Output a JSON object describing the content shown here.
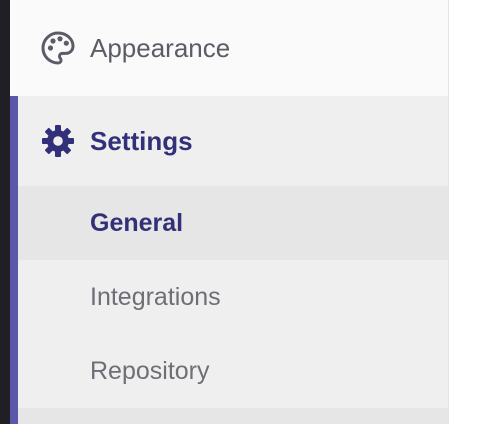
{
  "sidebar": {
    "appearance": {
      "label": "Appearance",
      "icon": "palette-icon"
    },
    "settings": {
      "label": "Settings",
      "icon": "gear-icon",
      "children": [
        {
          "label": "General",
          "active": true
        },
        {
          "label": "Integrations",
          "active": false
        },
        {
          "label": "Repository",
          "active": false
        }
      ]
    }
  },
  "colors": {
    "accent": "#5b57a9",
    "active_text": "#33307a",
    "muted_text": "#6e6e77",
    "active_section_bg": "#efefef",
    "active_item_bg": "#e6e6e6"
  }
}
